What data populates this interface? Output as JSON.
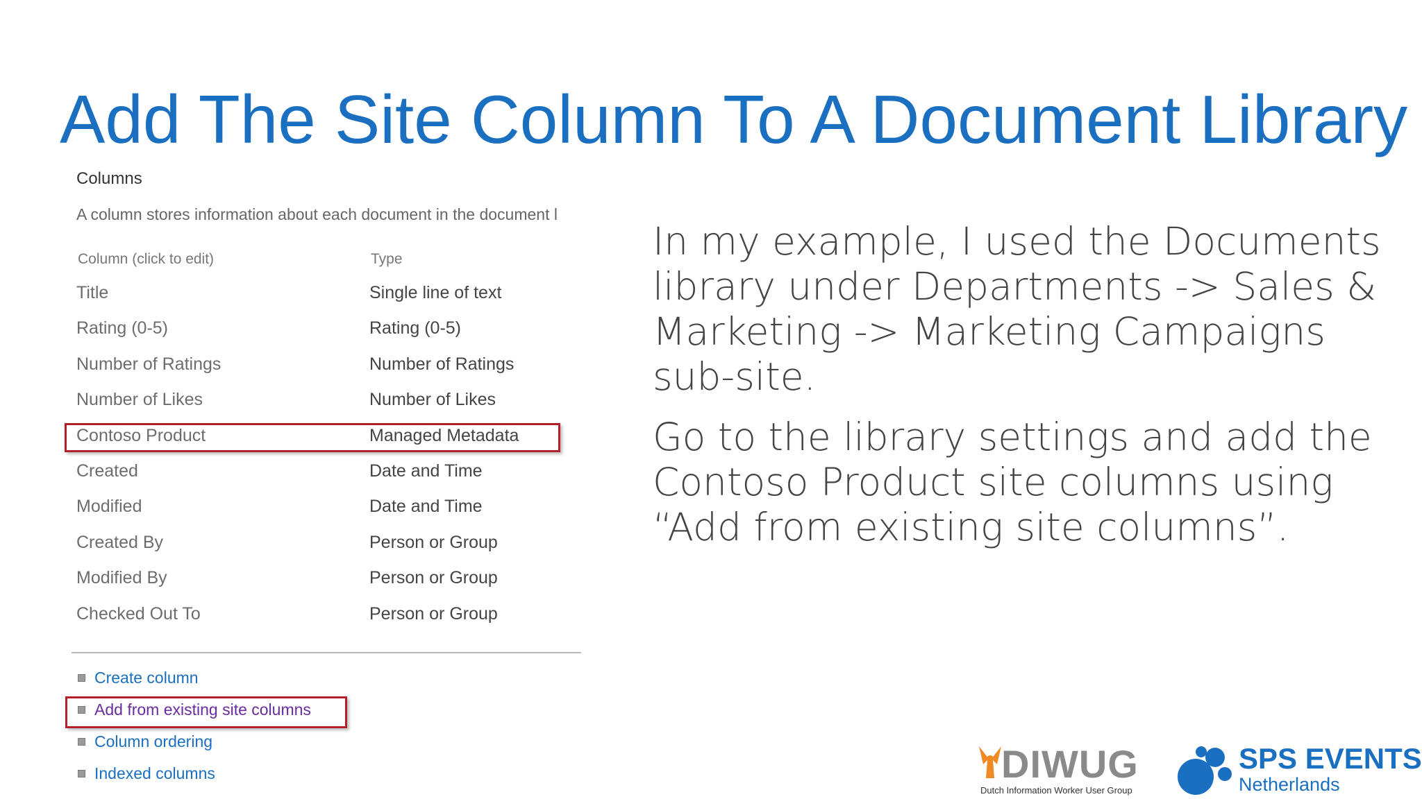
{
  "slide": {
    "title": "Add The Site Column To A Document Library"
  },
  "columns_panel": {
    "heading": "Columns",
    "description": "A column stores information about each document in the document l",
    "header_name": "Column (click to edit)",
    "header_type": "Type",
    "rows": [
      {
        "name": "Title",
        "type": "Single line of text"
      },
      {
        "name": "Rating (0-5)",
        "type": "Rating (0-5)"
      },
      {
        "name": "Number of Ratings",
        "type": "Number of Ratings"
      },
      {
        "name": "Number of Likes",
        "type": "Number of Likes"
      },
      {
        "name": "Contoso Product",
        "type": "Managed Metadata"
      },
      {
        "name": "Created",
        "type": "Date and Time"
      },
      {
        "name": "Modified",
        "type": "Date and Time"
      },
      {
        "name": "Created By",
        "type": "Person or Group"
      },
      {
        "name": "Modified By",
        "type": "Person or Group"
      },
      {
        "name": "Checked Out To",
        "type": "Person or Group"
      }
    ],
    "links": [
      {
        "label": "Create column"
      },
      {
        "label": "Add from existing site columns"
      },
      {
        "label": "Column ordering"
      },
      {
        "label": "Indexed columns"
      }
    ]
  },
  "body_text": {
    "paragraph1": "In my example, I used the Documents library under Departments -> Sales & Marketing -> Marketing Campaigns sub-site.",
    "paragraph2": "Go to the library settings and add the Contoso Product site columns using “Add from existing site columns”."
  },
  "logos": {
    "diwug_name": "DIWUG",
    "diwug_tagline": "Dutch Information Worker User Group",
    "sps_name": "SPS EVENTS",
    "sps_region": "Netherlands"
  },
  "colors": {
    "accent_blue": "#1a6fc0",
    "highlight_red": "#b3202a",
    "diwug_orange": "#f08a24",
    "visited_link": "#6a2ba0"
  }
}
